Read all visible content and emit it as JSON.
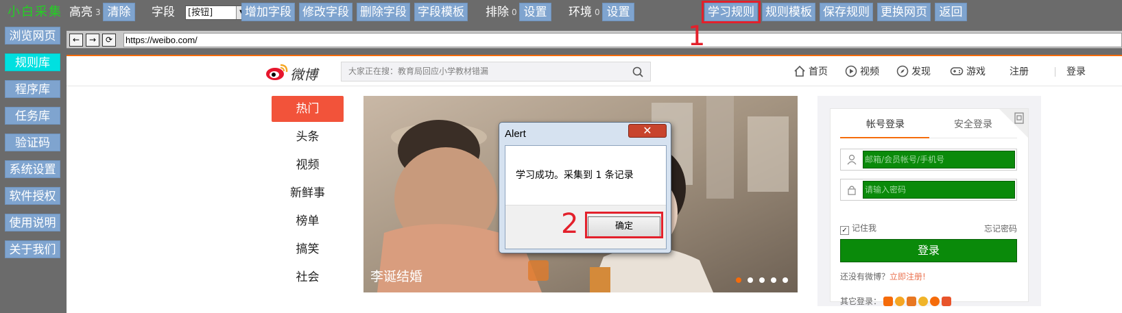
{
  "app": {
    "logo": "小白采集"
  },
  "toolbar": {
    "highlight_label": "高亮",
    "highlight_count": "3",
    "clear_btn": "清除",
    "field_label": "字段",
    "field_select": "[按钮]",
    "add_field": "增加字段",
    "edit_field": "修改字段",
    "delete_field": "删除字段",
    "field_template": "字段模板",
    "exclude_label": "排除",
    "exclude_count": "0",
    "exclude_settings": "设置",
    "env_label": "环境",
    "env_count": "0",
    "env_settings": "设置",
    "learn_rules": "学习规则",
    "rule_templates": "规则模板",
    "save_rules": "保存规则",
    "change_page": "更换网页",
    "back": "返回"
  },
  "sidebar": {
    "items": [
      {
        "label": "浏览网页"
      },
      {
        "label": "规则库",
        "active": true
      },
      {
        "label": "程序库"
      },
      {
        "label": "任务库"
      },
      {
        "label": "验证码"
      },
      {
        "label": "系统设置"
      },
      {
        "label": "软件授权"
      },
      {
        "label": "使用说明"
      },
      {
        "label": "关于我们"
      }
    ]
  },
  "browser": {
    "back_glyph": "←",
    "forward_glyph": "→",
    "refresh_glyph": "⟳",
    "url": "https://weibo.com/"
  },
  "annotations": {
    "step1": "1",
    "step2": "2",
    "color": "#e3202b"
  },
  "weibo": {
    "logo_text": "微博",
    "search_placeholder": "大家正在搜：教育局回应小学教材错漏",
    "nav": {
      "home": "首页",
      "video": "视频",
      "discover": "发现",
      "game": "游戏",
      "register": "注册",
      "login": "登录"
    },
    "categories": [
      "热门",
      "头条",
      "视频",
      "新鲜事",
      "榜单",
      "搞笑",
      "社会"
    ],
    "carousel": {
      "caption": "李诞结婚",
      "dot_count": 5,
      "active_dot": 0
    },
    "login_panel": {
      "tab_account": "帐号登录",
      "tab_secure": "安全登录",
      "username_placeholder": "邮箱/会员帐号/手机号",
      "password_placeholder": "请输入密码",
      "remember": "记住我",
      "forgot": "忘记密码",
      "login_btn": "登录",
      "no_account": "还没有微博？",
      "register_now": "立即注册!",
      "other_login": "其它登录："
    }
  },
  "alert": {
    "title": "Alert",
    "close_glyph": "✕",
    "message": "学习成功。采集到 1 条记录",
    "ok_btn": "确定"
  },
  "colors": {
    "toolbar_bg": "#6b6b6b",
    "button_bg": "#7fa4cf",
    "active_sidebar": "#00e0e0",
    "weibo_orange": "#f56b0a",
    "green_field": "#0a8a0a"
  }
}
